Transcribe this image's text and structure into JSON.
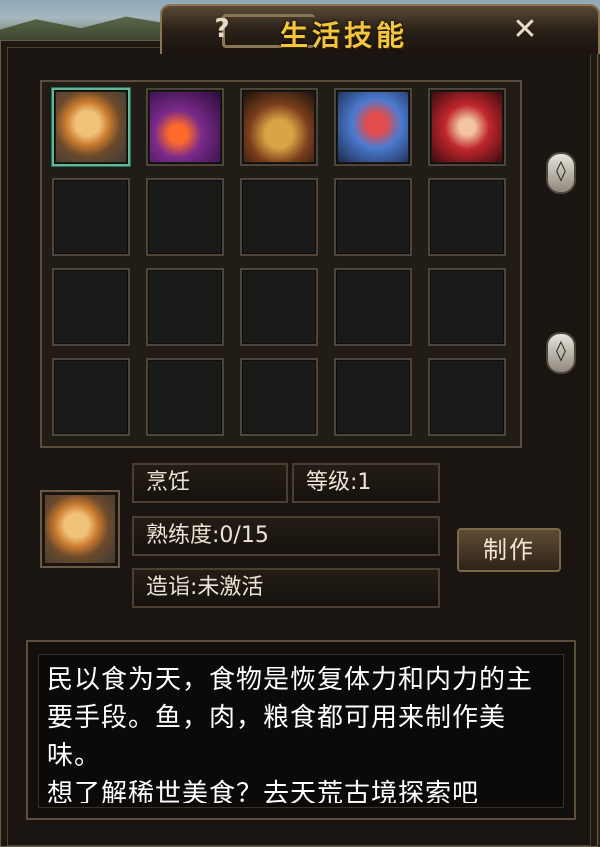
{
  "window": {
    "title": "生活技能",
    "help_label": "?",
    "close_label": "✕"
  },
  "skills": [
    {
      "name": "cooking-skill",
      "icon": "roast-chicken-icon",
      "selected": true
    },
    {
      "name": "forging-skill",
      "icon": "forge-icon",
      "selected": false
    },
    {
      "name": "casting-skill",
      "icon": "anvil-icon",
      "selected": false
    },
    {
      "name": "tailoring-skill",
      "icon": "fabric-icon",
      "selected": false
    },
    {
      "name": "crafting-skill",
      "icon": "needle-icon",
      "selected": false
    }
  ],
  "scroll": {
    "up_label": "◊",
    "down_label": "◊"
  },
  "detail": {
    "skill_name": "烹饪",
    "level_text": "等级:1",
    "proficiency_text": "熟练度:0/15",
    "mastery_text": "造诣:未激活",
    "make_button_label": "制作",
    "description": "民以食为天，食物是恢复体力和内力的主要手段。鱼，肉，粮食都可用来制作美味。\n想了解稀世美食？去天荒古境探索吧"
  }
}
